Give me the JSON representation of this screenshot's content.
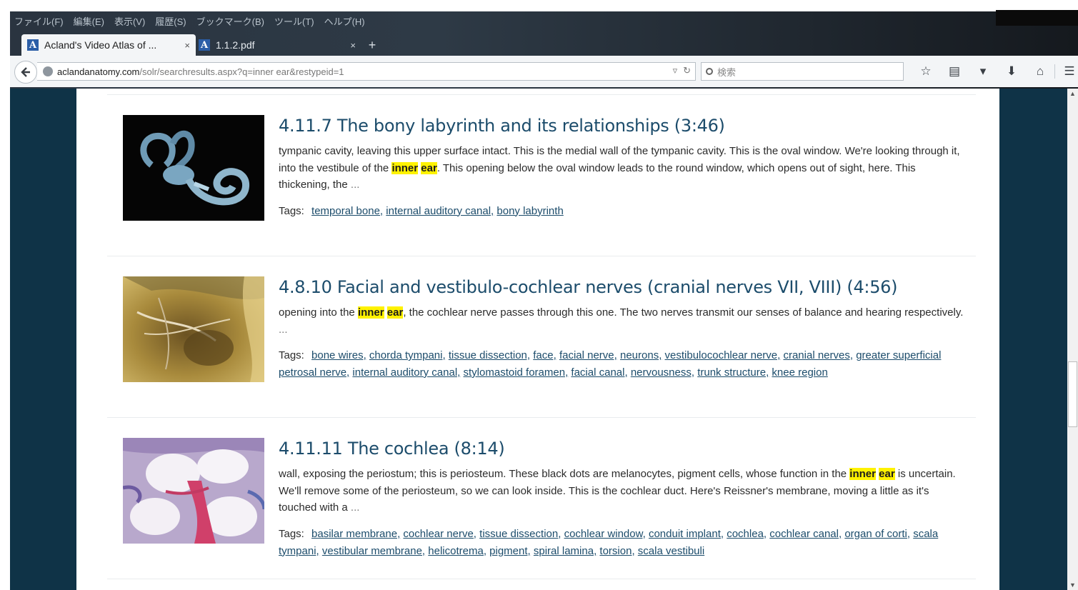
{
  "browser": {
    "menu": [
      "ファイル(F)",
      "編集(E)",
      "表示(V)",
      "履歴(S)",
      "ブックマーク(B)",
      "ツール(T)",
      "ヘルプ(H)"
    ],
    "tabs": [
      {
        "title": "Acland's Video Atlas of ...",
        "close": "×",
        "favicon": "A"
      },
      {
        "title": "1.1.2.pdf",
        "close": "×",
        "favicon": "A"
      }
    ],
    "new_tab": "+",
    "url_host": "aclandanatomy.com",
    "url_path": "/solr/searchresults.aspx?q=inner ear&restypeid=1",
    "search_placeholder": "検索"
  },
  "results": [
    {
      "title": "4.11.7 The bony labyrinth and its relationships (3:46)",
      "snippet_before": "tympanic cavity, leaving this upper surface intact. This is the medial wall of the tympanic cavity. This is the oval window. We're looking through it, into the vestibule of the ",
      "hl1": "inner",
      "hl2": "ear",
      "snippet_after": ". This opening below the oval window leads to the round window, which opens out of sight, here. This thickening, the ",
      "ellipsis": "...",
      "tags_label": "Tags:",
      "tags": [
        "temporal bone,",
        "internal auditory canal,",
        "bony labyrinth"
      ]
    },
    {
      "title": "4.8.10 Facial and vestibulo-cochlear nerves (cranial nerves VII, VIII) (4:56)",
      "snippet_before": "opening into the ",
      "hl1": "inner",
      "hl2": "ear",
      "snippet_after": ", the cochlear nerve passes through this one. The two nerves transmit our senses of balance and hearing respectively. ",
      "ellipsis": "...",
      "tags_label": "Tags:",
      "tags": [
        "bone wires,",
        "chorda tympani,",
        "tissue dissection,",
        "face,",
        "facial nerve,",
        "neurons,",
        "vestibulocochlear nerve,",
        "cranial nerves,",
        "greater superficial petrosal nerve,",
        "internal auditory canal,",
        "stylomastoid foramen,",
        "facial canal,",
        "nervousness,",
        "trunk structure,",
        "knee region"
      ]
    },
    {
      "title": "4.11.11 The cochlea (8:14)",
      "snippet_before": "wall, exposing the periostum; this is periosteum. These black dots are melanocytes, pigment cells, whose function in the ",
      "hl1": "inner",
      "hl2": "ear",
      "snippet_after": " is uncertain. We'll remove some of the periosteum, so we can look inside. This is the cochlear duct. Here's Reissner's membrane, moving a little as it's touched with a ",
      "ellipsis": "...",
      "tags_label": "Tags:",
      "tags": [
        "basilar membrane,",
        "cochlear nerve,",
        "tissue dissection,",
        "cochlear window,",
        "conduit implant,",
        "cochlea,",
        "cochlear canal,",
        "organ of corti,",
        "scala tympani,",
        "vestibular membrane,",
        "helicotrema,",
        "pigment,",
        "spiral lamina,",
        "torsion,",
        "scala vestibuli"
      ]
    }
  ]
}
